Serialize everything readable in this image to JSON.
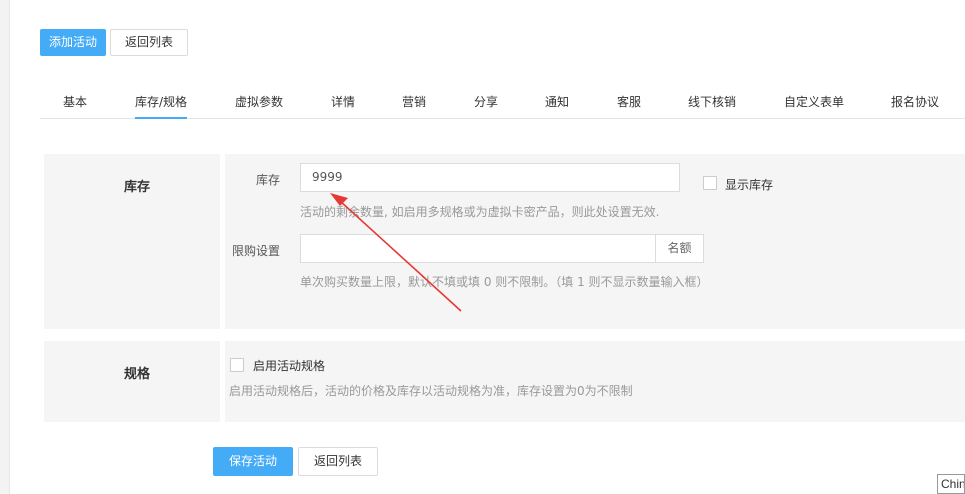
{
  "header": {
    "add_activity_label": "添加活动",
    "back_list_label": "返回列表"
  },
  "tabs": [
    {
      "label": "基本"
    },
    {
      "label": "库存/规格"
    },
    {
      "label": "虚拟参数"
    },
    {
      "label": "详情"
    },
    {
      "label": "营销"
    },
    {
      "label": "分享"
    },
    {
      "label": "通知"
    },
    {
      "label": "客服"
    },
    {
      "label": "线下核销"
    },
    {
      "label": "自定义表单"
    },
    {
      "label": "报名协议"
    }
  ],
  "active_tab": "库存/规格",
  "stock_section": {
    "title": "库存",
    "stock_label": "库存",
    "stock_value": "9999",
    "show_stock_label": "显示库存",
    "stock_help": "活动的剩余数量, 如启用多规格或为虚拟卡密产品，则此处设置无效.",
    "limit_label": "限购设置",
    "limit_value": "",
    "limit_addon": "名额",
    "limit_help": "单次购买数量上限，默认不填或填 0 则不限制。（填 1 则不显示数量输入框）"
  },
  "spec_section": {
    "title": "规格",
    "enable_label": "启用活动规格",
    "help": "启用活动规格后，活动的价格及库存以活动规格为准，库存设置为0为不限制"
  },
  "footer": {
    "save_label": "保存活动",
    "back_list_label": "返回列表"
  },
  "ime_indicator": "Chin",
  "colors": {
    "primary": "#44abf7",
    "annotation_arrow": "#e53935"
  }
}
